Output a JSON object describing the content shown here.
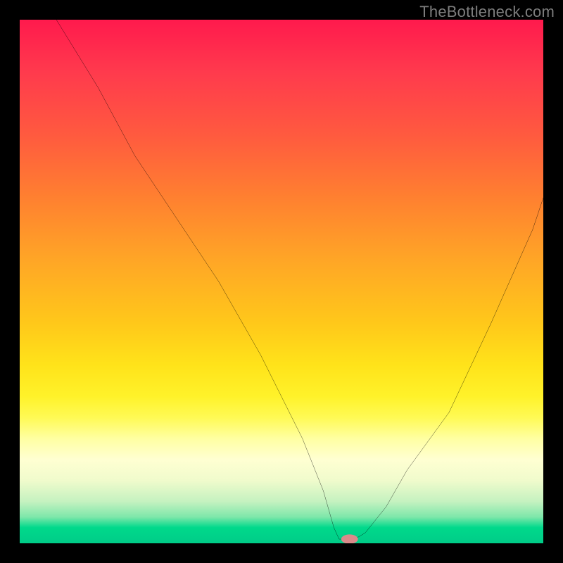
{
  "watermark": "TheBottleneck.com",
  "chart_data": {
    "type": "line",
    "title": "",
    "xlabel": "",
    "ylabel": "",
    "xlim": [
      0,
      100
    ],
    "ylim": [
      0,
      100
    ],
    "grid": false,
    "legend": false,
    "series": [
      {
        "name": "bottleneck-curve",
        "x": [
          7,
          15,
          22,
          30,
          38,
          46,
          54,
          58,
          60,
          62,
          64,
          68,
          74,
          82,
          90,
          98,
          100
        ],
        "y": [
          100,
          87,
          74,
          62,
          50,
          36,
          20,
          10,
          3,
          0,
          0,
          3,
          10,
          25,
          42,
          60,
          66
        ]
      }
    ],
    "marker": {
      "x": 63,
      "y": 0,
      "color": "#d98a8a"
    },
    "background_gradient": {
      "top": "#ff1a4d",
      "middle": "#fff22a",
      "bottom": "#00cc88"
    }
  }
}
